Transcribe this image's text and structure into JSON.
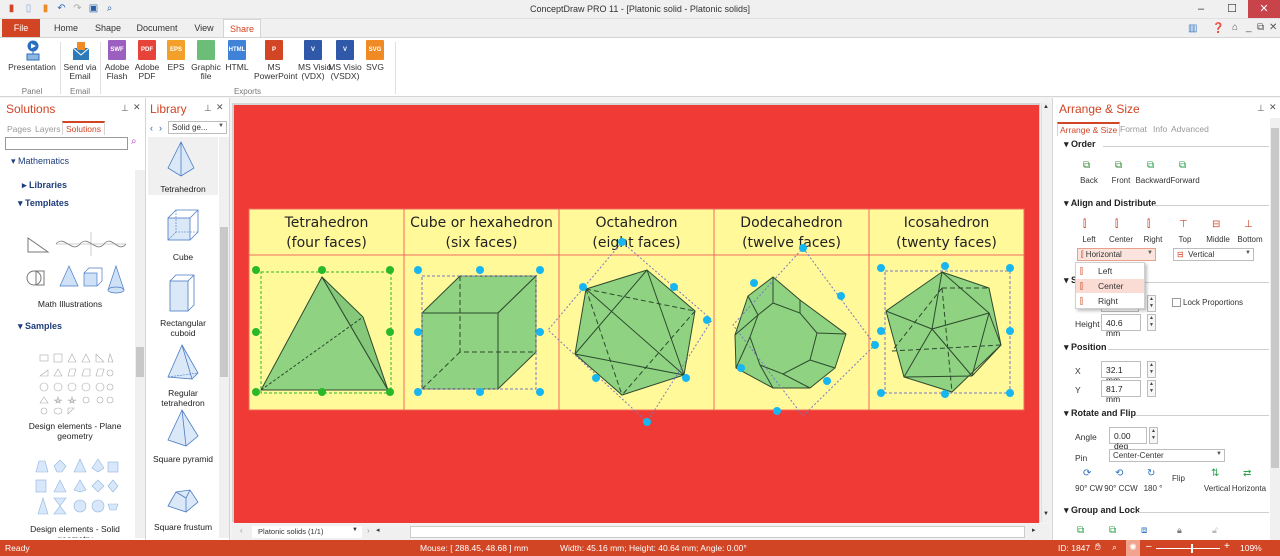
{
  "app": {
    "title": "ConceptDraw PRO 11 - [Platonic solid - Platonic solids]",
    "window_controls": {
      "minimize": "–",
      "maximize": "☐",
      "close": "✕"
    }
  },
  "quick_access": [
    "app-logo-icon",
    "new-icon",
    "open-icon",
    "undo-icon",
    "redo-icon",
    "save-icon",
    "print-preview-icon"
  ],
  "ribbon": {
    "tabs": [
      {
        "label": "File"
      },
      {
        "label": "Home"
      },
      {
        "label": "Shape"
      },
      {
        "label": "Document"
      },
      {
        "label": "View"
      },
      {
        "label": "Share",
        "active": true
      }
    ],
    "groups": [
      {
        "label": "Panel",
        "buttons": [
          {
            "label": "Presentation",
            "icon": "presentation-icon"
          }
        ]
      },
      {
        "label": "Email",
        "buttons": [
          {
            "label": "Send via\nEmail",
            "icon": "email-icon"
          }
        ]
      },
      {
        "label": "Exports",
        "buttons": [
          {
            "label": "Adobe\nFlash",
            "icon": "swf-icon",
            "badge": "SWF",
            "color": "#9b5fc0"
          },
          {
            "label": "Adobe\nPDF",
            "icon": "pdf-icon",
            "badge": "PDF",
            "color": "#e6443a"
          },
          {
            "label": "EPS",
            "icon": "eps-icon",
            "badge": "EPS",
            "color": "#f3a02a"
          },
          {
            "label": "Graphic\nfile",
            "icon": "image-file-icon",
            "badge": "",
            "color": "#6cbd78"
          },
          {
            "label": "HTML",
            "icon": "html-icon",
            "badge": "HTML",
            "color": "#3f82d8"
          },
          {
            "label": "MS\nPowerPoint",
            "icon": "powerpoint-icon",
            "badge": "P",
            "color": "#d24625"
          },
          {
            "label": "MS Visio\n(VDX)",
            "icon": "visio-vdx-icon",
            "badge": "V",
            "color": "#3058a8"
          },
          {
            "label": "MS Visio\n(VSDX)",
            "icon": "visio-vsdx-icon",
            "badge": "V",
            "color": "#3058a8"
          },
          {
            "label": "SVG",
            "icon": "svg-icon",
            "badge": "SVG",
            "color": "#f08a24"
          }
        ]
      }
    ]
  },
  "solutions_panel": {
    "title": "Solutions",
    "subtabs": [
      "Pages",
      "Layers",
      "Solutions"
    ],
    "active_subtab": "Solutions",
    "search_placeholder": "",
    "tree": {
      "root": "Mathematics",
      "libraries": "Libraries",
      "templates": "Templates",
      "template_items": [
        "Math Illustrations"
      ],
      "samples": "Samples",
      "sample_items": [
        "Design elements - Plane geometry",
        "Design elements - Solid geometry"
      ]
    }
  },
  "library_panel": {
    "title": "Library",
    "selector": "Solid ge...",
    "items": [
      "Tetrahedron",
      "Cube",
      "Rectangular cuboid",
      "Regular tetrahedron",
      "Square pyramid",
      "Square frustum"
    ]
  },
  "canvas": {
    "page_tab": "Platonic solids (1/1)",
    "table": [
      {
        "name": "Tetrahedron",
        "faces": "(four faces)"
      },
      {
        "name": "Cube or hexahedron",
        "faces": "(six faces)"
      },
      {
        "name": "Octahedron",
        "faces": "(eight faces)"
      },
      {
        "name": "Dodecahedron",
        "faces": "(twelve faces)"
      },
      {
        "name": "Icosahedron",
        "faces": "(twenty faces)"
      }
    ],
    "colors": {
      "page": "#f03a36",
      "cell": "#fff99a",
      "solid": "#8fd282",
      "handle": "#17b6f0",
      "handle_selected": "#29b82a"
    }
  },
  "arrange_panel": {
    "title": "Arrange & Size",
    "subtabs": [
      "Arrange & Size",
      "Format",
      "Info",
      "Advanced"
    ],
    "active_subtab": "Arrange & Size",
    "order": {
      "title": "Order",
      "buttons": [
        "Back",
        "Front",
        "Backward",
        "Forward"
      ]
    },
    "align": {
      "title": "Align and Distribute",
      "buttons": [
        "Left",
        "Center",
        "Right",
        "Top",
        "Middle",
        "Bottom"
      ],
      "horizontal_select": "Horizontal",
      "vertical_select": "Vertical",
      "menu": [
        "Left",
        "Center",
        "Right"
      ],
      "menu_selected": "Center"
    },
    "size": {
      "title": "Size",
      "height_label": "Height",
      "height": "40.6 mm",
      "lock_label": "Lock Proportions",
      "lock_checked": false
    },
    "position": {
      "title": "Position",
      "x_label": "X",
      "x": "32.1 mm",
      "y_label": "Y",
      "y": "81.7 mm"
    },
    "rotate": {
      "title": "Rotate and Flip",
      "angle_label": "Angle",
      "angle": "0.00 deg",
      "pin_label": "Pin",
      "pin": "Center-Center",
      "flip_label": "Flip",
      "buttons": [
        "90° CW",
        "90° CCW",
        "180 °",
        "Vertical",
        "Horizonta"
      ]
    },
    "group": {
      "title": "Group and Lock"
    }
  },
  "status": {
    "ready": "Ready",
    "mouse": "Mouse: [ 288.45, 48.68 ] mm",
    "dims": "Width: 45.16 mm;  Height: 40.64 mm;  Angle: 0.00°",
    "id": "ID: 1847",
    "zoom": "109%",
    "zoom_level": 0.55
  }
}
